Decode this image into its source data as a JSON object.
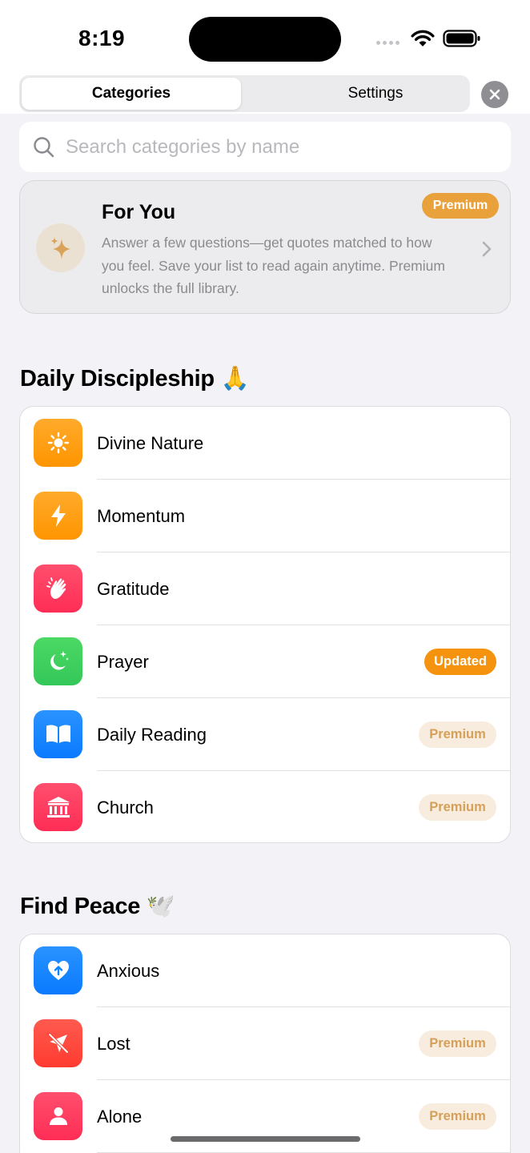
{
  "status_bar": {
    "time": "8:19"
  },
  "tabs": [
    {
      "label": "Categories",
      "active": true
    },
    {
      "label": "Settings",
      "active": false
    }
  ],
  "search": {
    "placeholder": "Search categories by name",
    "value": ""
  },
  "for_you": {
    "title": "For You",
    "badge": "Premium",
    "description": "Answer a few questions—get quotes matched to how you feel. Save your list to read again anytime. Premium unlocks the full library."
  },
  "sections": [
    {
      "title": "Daily Discipleship 🙏",
      "items": [
        {
          "label": "Divine Nature",
          "icon": "sun-icon",
          "color": "#ff9f0a",
          "badge": ""
        },
        {
          "label": "Momentum",
          "icon": "bolt-icon",
          "color": "#ff9f0a",
          "badge": ""
        },
        {
          "label": "Gratitude",
          "icon": "clapping-hands-icon",
          "color": "#ff375f",
          "badge": ""
        },
        {
          "label": "Prayer",
          "icon": "moon-stars-icon",
          "color": "#34c759",
          "badge": "Updated"
        },
        {
          "label": "Daily Reading",
          "icon": "book-icon",
          "color": "#0a84ff",
          "badge": "Premium"
        },
        {
          "label": "Church",
          "icon": "building-columns-icon",
          "color": "#ff375f",
          "badge": "Premium"
        }
      ]
    },
    {
      "title": "Find Peace 🕊️",
      "items": [
        {
          "label": "Anxious",
          "icon": "heart-arrow-icon",
          "color": "#0a84ff",
          "badge": ""
        },
        {
          "label": "Lost",
          "icon": "location-slash-icon",
          "color": "#ff3b30",
          "badge": "Premium"
        },
        {
          "label": "Alone",
          "icon": "person-icon",
          "color": "#ff375f",
          "badge": "Premium"
        }
      ]
    }
  ]
}
